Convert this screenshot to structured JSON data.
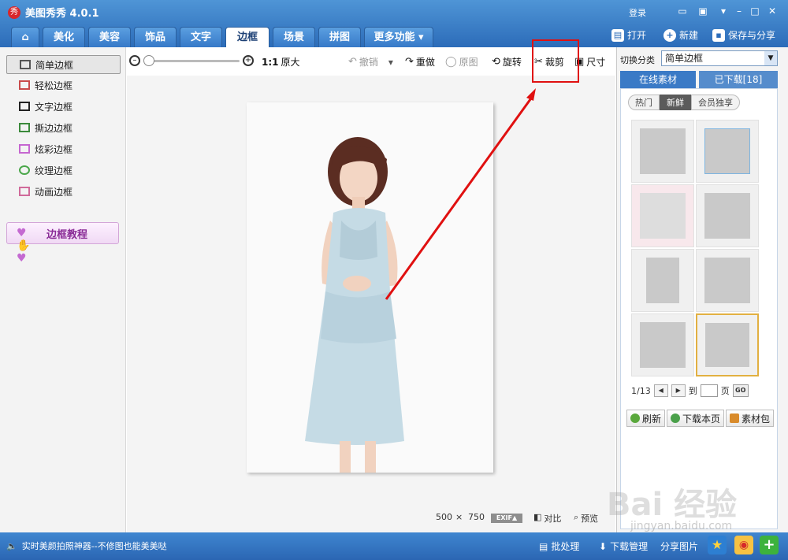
{
  "app": {
    "title": "美图秀秀 4.0.1",
    "logo_text": "秀",
    "login": "登录"
  },
  "window_controls": [
    "minimize-icon",
    "maximize-icon",
    "close-icon"
  ],
  "tabs": [
    {
      "label": "美化"
    },
    {
      "label": "美容"
    },
    {
      "label": "饰品"
    },
    {
      "label": "文字"
    },
    {
      "label": "边框",
      "active": true
    },
    {
      "label": "场景"
    },
    {
      "label": "拼图"
    },
    {
      "label": "更多功能 ▾"
    }
  ],
  "top_actions": {
    "open": "打开",
    "new": "新建",
    "save_share": "保存与分享"
  },
  "left_panel": {
    "items": [
      "简单边框",
      "轻松边框",
      "文字边框",
      "撕边边框",
      "炫彩边框",
      "纹理边框",
      "动画边框"
    ],
    "active_index": 0,
    "tutorial": "边框教程"
  },
  "toolbar": {
    "actual_size": "1:1",
    "original_size": "原大",
    "undo": "撤销",
    "redo": "重做",
    "original": "原图",
    "rotate": "旋转",
    "crop": "裁剪",
    "resize": "尺寸"
  },
  "canvas_status": {
    "width": "500",
    "times": "×",
    "height": "750",
    "exif": "EXIF▲",
    "compare": "对比",
    "preview": "预览"
  },
  "right_panel": {
    "category_label": "切换分类",
    "category_value": "简单边框",
    "tab_online": "在线素材",
    "tab_downloaded": "已下载[18]",
    "pills": [
      "热门",
      "新鲜",
      "会员独享"
    ],
    "active_pill": 1,
    "page_info": "1/13",
    "goto_label": "到",
    "page_suffix": "页",
    "go": "GO",
    "refresh": "刷新",
    "download_page": "下载本页",
    "material_pack": "素材包"
  },
  "bottom_bar": {
    "tip": "实时美颜拍照神器--不修图也能美美哒",
    "batch": "批处理",
    "download_manager": "下载管理",
    "share_image": "分享图片"
  },
  "watermark": {
    "brand": "Bai 经验",
    "url": "jingyan.baidu.com"
  },
  "colors": {
    "title_bar": "#2c6cb9",
    "highlight": "#e01010",
    "arrow": "#e01010"
  }
}
